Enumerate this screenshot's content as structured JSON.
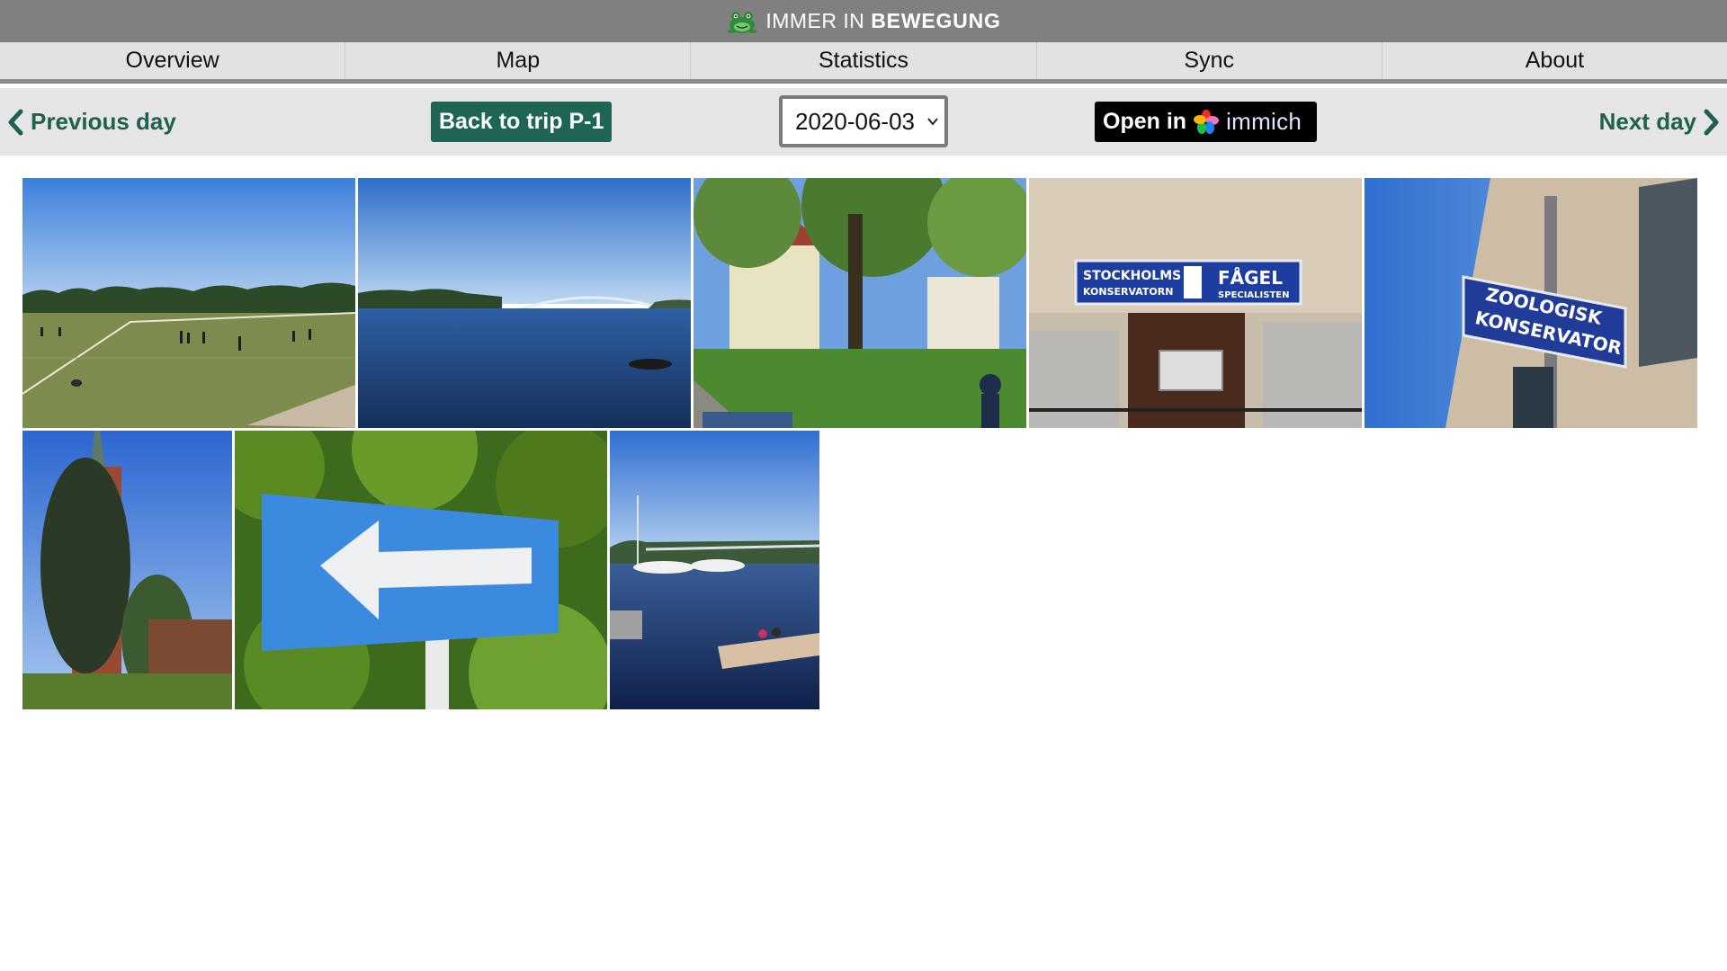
{
  "header": {
    "logo_icon": "frog-icon",
    "brand_regular": "IMMER IN",
    "brand_bold": "BEWEGUNG"
  },
  "nav": {
    "items": [
      {
        "label": "Overview"
      },
      {
        "label": "Map"
      },
      {
        "label": "Statistics"
      },
      {
        "label": "Sync"
      },
      {
        "label": "About"
      }
    ]
  },
  "daybar": {
    "previous_label": "Previous day",
    "next_label": "Next day",
    "back_label": "Back to trip P-1",
    "date_value": "2020-06-03",
    "open_in_label": "Open in",
    "immich_label": "immich",
    "accent_color": "#206050"
  },
  "photos": [
    {
      "subject": "football-field-photo"
    },
    {
      "subject": "lake-bridge-photo"
    },
    {
      "subject": "garden-house-photo"
    },
    {
      "subject": "stockholms-konservatorn-sign-photo",
      "sign_line1": "STOCKHOLMS",
      "sign_line2": "KONSERVATORN",
      "sign_line3": "FÅGEL",
      "sign_line4": "SPECIALISTEN"
    },
    {
      "subject": "zoologisk-konservator-sign-photo",
      "sign_line1": "ZOOLOGISK",
      "sign_line2": "KONSERVATOR"
    },
    {
      "subject": "brick-tower-photo"
    },
    {
      "subject": "arrow-sign-photo"
    },
    {
      "subject": "marina-photo"
    }
  ]
}
